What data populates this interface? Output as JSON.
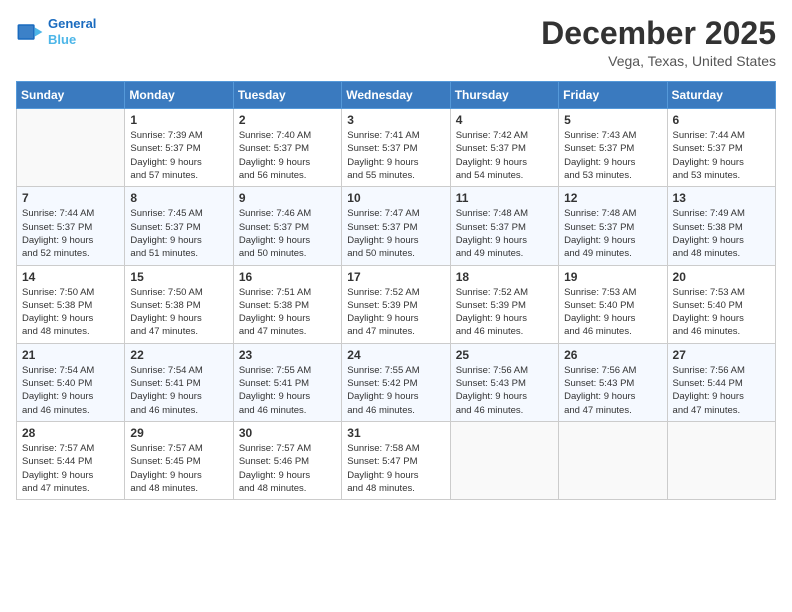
{
  "header": {
    "logo_line1": "General",
    "logo_line2": "Blue",
    "month_title": "December 2025",
    "location": "Vega, Texas, United States"
  },
  "days_of_week": [
    "Sunday",
    "Monday",
    "Tuesday",
    "Wednesday",
    "Thursday",
    "Friday",
    "Saturday"
  ],
  "weeks": [
    [
      {
        "day": "",
        "content": ""
      },
      {
        "day": "1",
        "content": "Sunrise: 7:39 AM\nSunset: 5:37 PM\nDaylight: 9 hours\nand 57 minutes."
      },
      {
        "day": "2",
        "content": "Sunrise: 7:40 AM\nSunset: 5:37 PM\nDaylight: 9 hours\nand 56 minutes."
      },
      {
        "day": "3",
        "content": "Sunrise: 7:41 AM\nSunset: 5:37 PM\nDaylight: 9 hours\nand 55 minutes."
      },
      {
        "day": "4",
        "content": "Sunrise: 7:42 AM\nSunset: 5:37 PM\nDaylight: 9 hours\nand 54 minutes."
      },
      {
        "day": "5",
        "content": "Sunrise: 7:43 AM\nSunset: 5:37 PM\nDaylight: 9 hours\nand 53 minutes."
      },
      {
        "day": "6",
        "content": "Sunrise: 7:44 AM\nSunset: 5:37 PM\nDaylight: 9 hours\nand 53 minutes."
      }
    ],
    [
      {
        "day": "7",
        "content": "Sunrise: 7:44 AM\nSunset: 5:37 PM\nDaylight: 9 hours\nand 52 minutes."
      },
      {
        "day": "8",
        "content": "Sunrise: 7:45 AM\nSunset: 5:37 PM\nDaylight: 9 hours\nand 51 minutes."
      },
      {
        "day": "9",
        "content": "Sunrise: 7:46 AM\nSunset: 5:37 PM\nDaylight: 9 hours\nand 50 minutes."
      },
      {
        "day": "10",
        "content": "Sunrise: 7:47 AM\nSunset: 5:37 PM\nDaylight: 9 hours\nand 50 minutes."
      },
      {
        "day": "11",
        "content": "Sunrise: 7:48 AM\nSunset: 5:37 PM\nDaylight: 9 hours\nand 49 minutes."
      },
      {
        "day": "12",
        "content": "Sunrise: 7:48 AM\nSunset: 5:37 PM\nDaylight: 9 hours\nand 49 minutes."
      },
      {
        "day": "13",
        "content": "Sunrise: 7:49 AM\nSunset: 5:38 PM\nDaylight: 9 hours\nand 48 minutes."
      }
    ],
    [
      {
        "day": "14",
        "content": "Sunrise: 7:50 AM\nSunset: 5:38 PM\nDaylight: 9 hours\nand 48 minutes."
      },
      {
        "day": "15",
        "content": "Sunrise: 7:50 AM\nSunset: 5:38 PM\nDaylight: 9 hours\nand 47 minutes."
      },
      {
        "day": "16",
        "content": "Sunrise: 7:51 AM\nSunset: 5:38 PM\nDaylight: 9 hours\nand 47 minutes."
      },
      {
        "day": "17",
        "content": "Sunrise: 7:52 AM\nSunset: 5:39 PM\nDaylight: 9 hours\nand 47 minutes."
      },
      {
        "day": "18",
        "content": "Sunrise: 7:52 AM\nSunset: 5:39 PM\nDaylight: 9 hours\nand 46 minutes."
      },
      {
        "day": "19",
        "content": "Sunrise: 7:53 AM\nSunset: 5:40 PM\nDaylight: 9 hours\nand 46 minutes."
      },
      {
        "day": "20",
        "content": "Sunrise: 7:53 AM\nSunset: 5:40 PM\nDaylight: 9 hours\nand 46 minutes."
      }
    ],
    [
      {
        "day": "21",
        "content": "Sunrise: 7:54 AM\nSunset: 5:40 PM\nDaylight: 9 hours\nand 46 minutes."
      },
      {
        "day": "22",
        "content": "Sunrise: 7:54 AM\nSunset: 5:41 PM\nDaylight: 9 hours\nand 46 minutes."
      },
      {
        "day": "23",
        "content": "Sunrise: 7:55 AM\nSunset: 5:41 PM\nDaylight: 9 hours\nand 46 minutes."
      },
      {
        "day": "24",
        "content": "Sunrise: 7:55 AM\nSunset: 5:42 PM\nDaylight: 9 hours\nand 46 minutes."
      },
      {
        "day": "25",
        "content": "Sunrise: 7:56 AM\nSunset: 5:43 PM\nDaylight: 9 hours\nand 46 minutes."
      },
      {
        "day": "26",
        "content": "Sunrise: 7:56 AM\nSunset: 5:43 PM\nDaylight: 9 hours\nand 47 minutes."
      },
      {
        "day": "27",
        "content": "Sunrise: 7:56 AM\nSunset: 5:44 PM\nDaylight: 9 hours\nand 47 minutes."
      }
    ],
    [
      {
        "day": "28",
        "content": "Sunrise: 7:57 AM\nSunset: 5:44 PM\nDaylight: 9 hours\nand 47 minutes."
      },
      {
        "day": "29",
        "content": "Sunrise: 7:57 AM\nSunset: 5:45 PM\nDaylight: 9 hours\nand 48 minutes."
      },
      {
        "day": "30",
        "content": "Sunrise: 7:57 AM\nSunset: 5:46 PM\nDaylight: 9 hours\nand 48 minutes."
      },
      {
        "day": "31",
        "content": "Sunrise: 7:58 AM\nSunset: 5:47 PM\nDaylight: 9 hours\nand 48 minutes."
      },
      {
        "day": "",
        "content": ""
      },
      {
        "day": "",
        "content": ""
      },
      {
        "day": "",
        "content": ""
      }
    ]
  ]
}
